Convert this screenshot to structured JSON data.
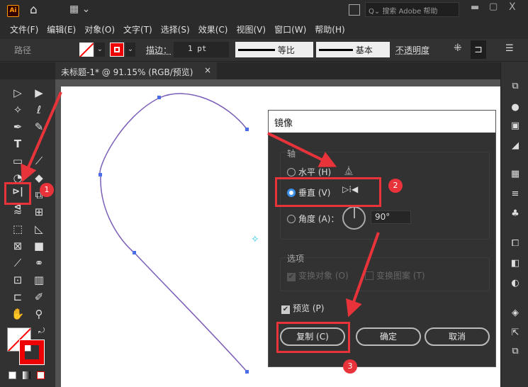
{
  "app": {
    "logo": "Ai",
    "search_placeholder": "搜索 Adobe 帮助"
  },
  "menu": [
    "文件(F)",
    "编辑(E)",
    "对象(O)",
    "文字(T)",
    "选择(S)",
    "效果(C)",
    "视图(V)",
    "窗口(W)",
    "帮助(H)"
  ],
  "control": {
    "object_type": "路径",
    "stroke_label": "描边：",
    "stroke_value": "1 pt",
    "profile_label": "等比",
    "brush_label": "基本",
    "opacity_label": "不透明度"
  },
  "document": {
    "tab_title": "未标题-1* @ 91.15% (RGB/预览)"
  },
  "dialog": {
    "title": "镜像",
    "axis_group": "轴",
    "horizontal": "水平 (H)",
    "vertical": "垂直 (V)",
    "angle": "角度 (A)：",
    "angle_value": "90°",
    "options_group": "选项",
    "transform_objects": "变换对象 (O)",
    "transform_patterns": "变换图案 (T)",
    "preview": "预览 (P)",
    "copy_button": "复制 (C)",
    "ok_button": "确定",
    "cancel_button": "取消",
    "selected_axis": "vertical"
  },
  "annotations": {
    "badge1": "1",
    "badge2": "2",
    "badge3": "3"
  },
  "colors": {
    "accent_red": "#e8333a",
    "path": "#7b5fb8",
    "radio": "#3b8fe8"
  }
}
